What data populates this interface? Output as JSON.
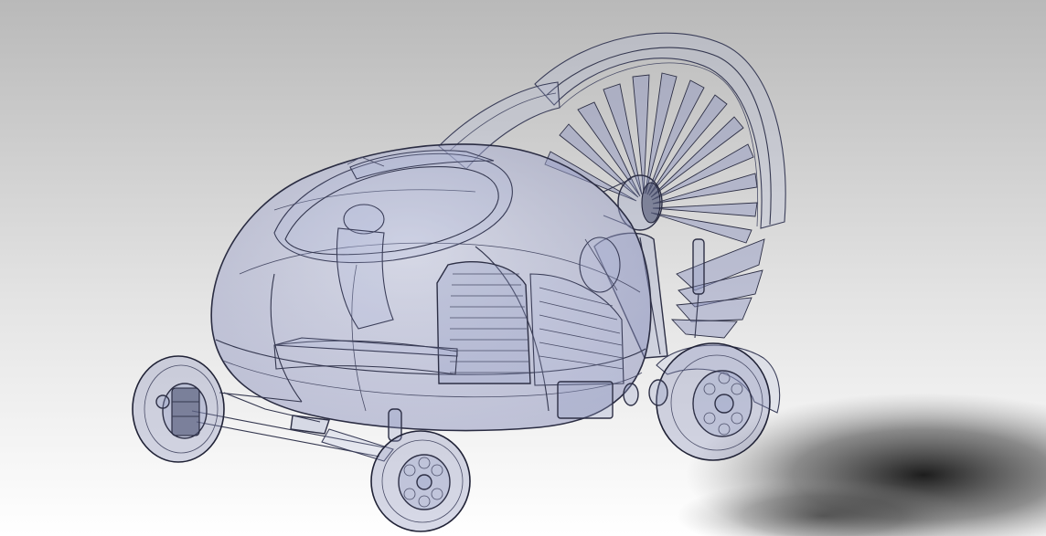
{
  "viewport": {
    "background_top": "#bdbdbd",
    "background_bottom": "#ffffff",
    "model_tint": "#9aa0c8",
    "edge_color": "#2d2f45",
    "floor_shadow": "#1c1c1c"
  },
  "model": {
    "icon": "transparent-fan-car-model-icon"
  }
}
